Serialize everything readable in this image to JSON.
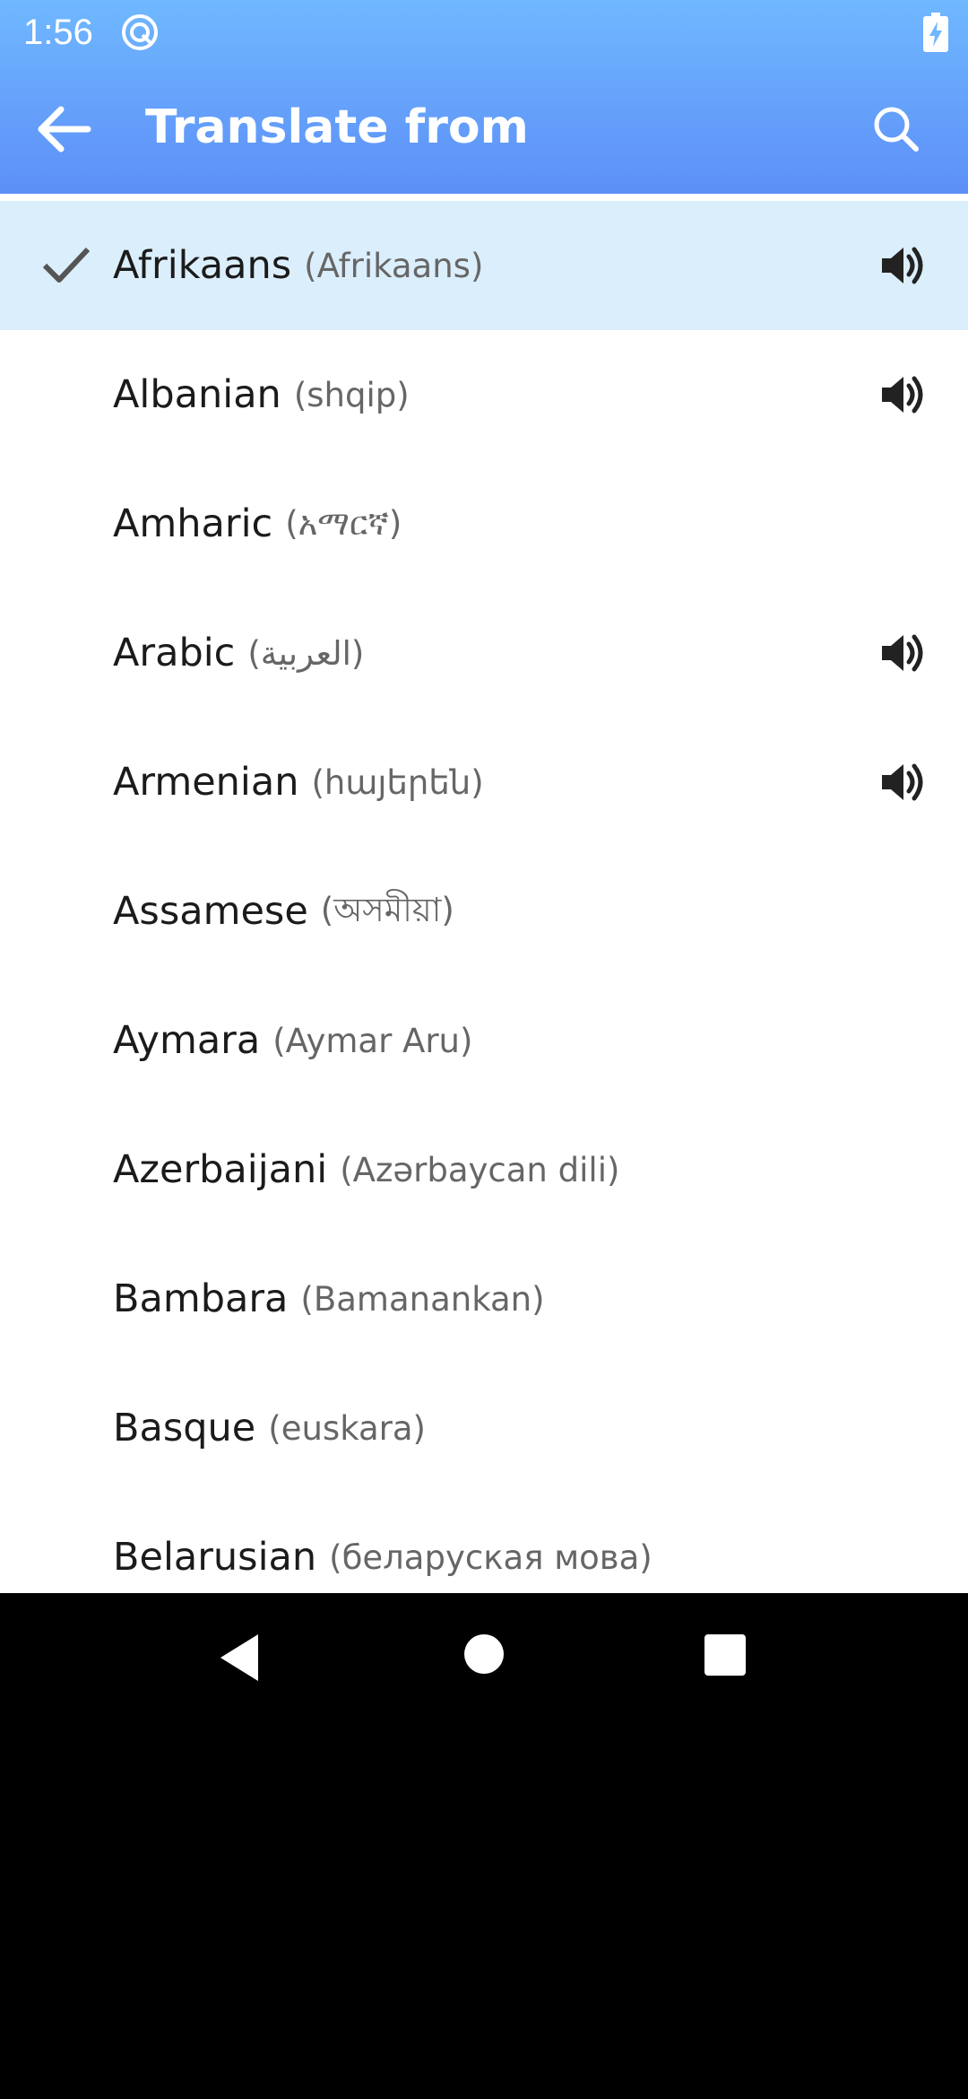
{
  "status_bar": {
    "time": "1:56",
    "icons": [
      "app-notification-icon",
      "battery-charging-icon"
    ]
  },
  "app_bar": {
    "title": "Translate from",
    "back_icon": "arrow-left-icon",
    "search_icon": "search-icon"
  },
  "colors": {
    "header_top": "#6fb8ff",
    "header_bottom": "#5d8ff7",
    "selected_row": "#dbeefc"
  },
  "languages": [
    {
      "name": "Afrikaans",
      "native": "(Afrikaans)",
      "selected": true,
      "speaker": true
    },
    {
      "name": "Albanian",
      "native": "(shqip)",
      "selected": false,
      "speaker": true
    },
    {
      "name": "Amharic",
      "native": "(አማርኛ)",
      "selected": false,
      "speaker": false
    },
    {
      "name": "Arabic",
      "native": "(العربية)",
      "selected": false,
      "speaker": true
    },
    {
      "name": "Armenian",
      "native": "(հայերեն)",
      "selected": false,
      "speaker": true
    },
    {
      "name": "Assamese",
      "native": "(অসমীয়া)",
      "selected": false,
      "speaker": false
    },
    {
      "name": "Aymara",
      "native": "(Aymar Aru)",
      "selected": false,
      "speaker": false
    },
    {
      "name": "Azerbaijani",
      "native": "(Azərbaycan dili)",
      "selected": false,
      "speaker": false
    },
    {
      "name": "Bambara",
      "native": "(Bamanankan)",
      "selected": false,
      "speaker": false
    },
    {
      "name": "Basque",
      "native": "(euskara)",
      "selected": false,
      "speaker": false
    },
    {
      "name": "Belarusian",
      "native": "(беларуская мова)",
      "selected": false,
      "speaker": false
    }
  ],
  "nav_bar": {
    "icons": [
      "nav-back-icon",
      "nav-home-icon",
      "nav-recents-icon"
    ]
  }
}
